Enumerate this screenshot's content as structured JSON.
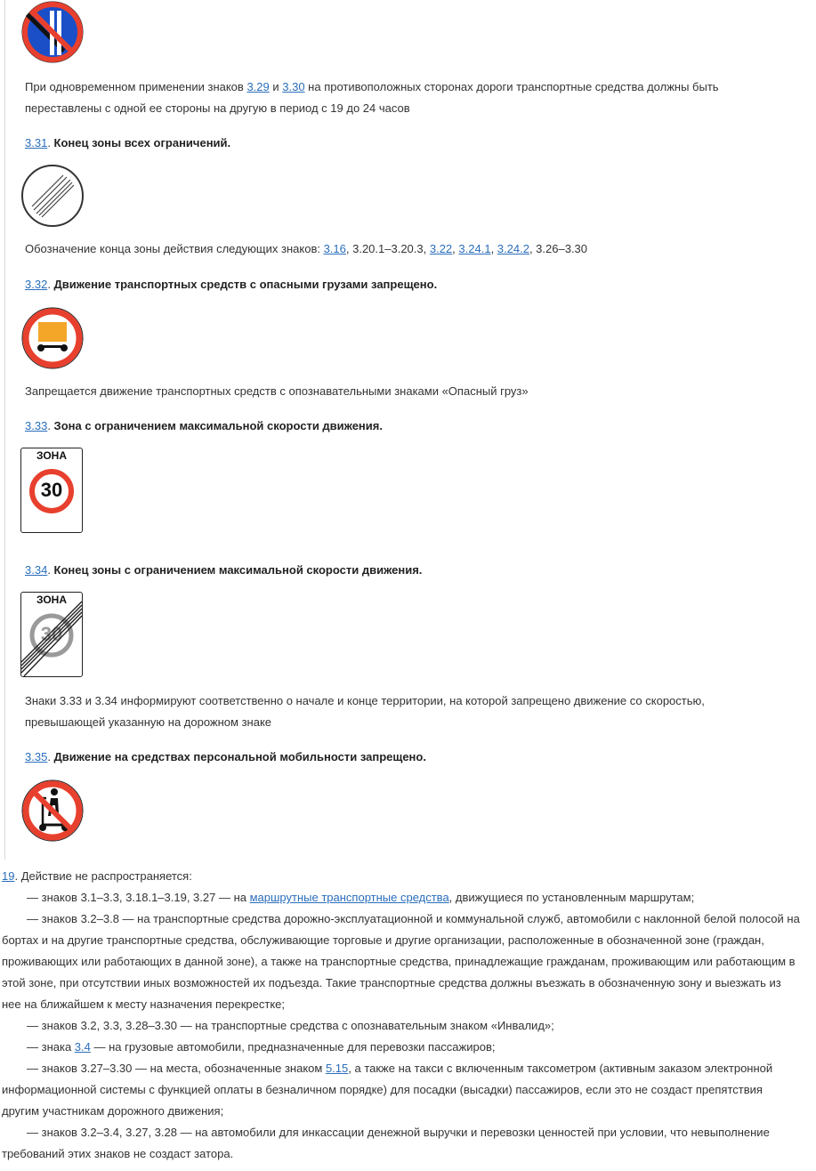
{
  "block": {
    "p329_330": {
      "t1": "При одновременном применении знаков ",
      "link1": "3.29",
      "t2": " и ",
      "link2": "3.30",
      "t3": " на противоположных сторонах дороги транспортные средства должны быть",
      "line2": "переставлены с одной ее стороны на другую в период с 19 до 24 часов"
    },
    "s331": {
      "num": "3.31",
      "title": "Конец зоны всех ограничений.",
      "desc_t1": "Обозначение конца зоны действия следующих знаков: ",
      "desc_l1": "3.16",
      "desc_t2": ", 3.20.1–3.20.3, ",
      "desc_l2": "3.22",
      "desc_t3": ", ",
      "desc_l3": "3.24.1",
      "desc_t4": ", ",
      "desc_l4": "3.24.2",
      "desc_t5": ", 3.26–3.30"
    },
    "s332": {
      "num": "3.32",
      "title": "Движение транспортных средств с опасными грузами запрещено.",
      "desc": "Запрещается движение транспортных средств с опознавательными знаками «Опасный груз»"
    },
    "s333": {
      "num": "3.33",
      "title": "Зона с ограничением максимальной скорости движения.",
      "zone": "ЗОНА",
      "speed": "30"
    },
    "s334": {
      "num": "3.34",
      "title": "Конец зоны с ограничением максимальной скорости движения.",
      "zone": "ЗОНА",
      "speed": "30",
      "desc1": "Знаки 3.33 и 3.34 информируют соответственно о начале и конце территории, на которой запрещено движение со скоростью,",
      "desc2": "превышающей указанную на дорожном знаке"
    },
    "s335": {
      "num": "3.35",
      "title": "Движение на средствах персональной мобильности запрещено."
    }
  },
  "footnote": {
    "num": "19",
    "intro": ". Действие не распространяется:",
    "i1_t1": "— знаков 3.1–3.3, 3.18.1–3.19, 3.27 — на ",
    "i1_link": "маршрутные транспортные средства",
    "i1_t2": ", движущиеся по установленным маршрутам;",
    "i2": "— знаков 3.2–3.8 — на транспортные средства дорожно-эксплуатационной и коммунальной служб, автомобили с наклонной белой полосой на бортах и на другие транспортные средства, обслуживающие торговые и другие организации, расположенные в обозначенной зоне (граждан, проживающих или работающих в данной зоне), а также на транспортные средства, принадлежащие гражданам, проживающим или работающим в этой зоне, при отсутствии иных возможностей их подъезда. Такие транспортные средства должны въезжать в обозначенную зону и выезжать из нее на ближайшем к месту назначения перекрестке;",
    "i3": "— знаков 3.2, 3.3, 3.28–3.30 — на транспортные средства с опознавательным знаком «Инвалид»;",
    "i4_t1": "— знака ",
    "i4_link": "3.4",
    "i4_t2": " — на грузовые автомобили, предназначенные для перевозки пассажиров;",
    "i5_t1": "— знаков 3.27–3.30 — на места, обозначенные знаком ",
    "i5_link": "5.15",
    "i5_t2": ", а также на такси с включенным таксометром (активным заказом электронной информационной системы с функцией оплаты в безналичном порядке) для посадки (высадки) пассажиров, если это не создаст препятствия другим участникам дорожного движения;",
    "i6": "— знаков 3.2–3.4, 3.27, 3.28 — на автомобили для инкассации денежной выручки и перевозки ценностей при условии, что невыполнение требований этих знаков не создаст затора."
  },
  "colors": {
    "link": "#2a6ebb",
    "sign_red": "#e8402e",
    "sign_blue": "#1a4fc8",
    "cargo_orange": "#f4a629"
  },
  "icons": [
    "no-parking-even-days-sign-icon",
    "end-of-all-restrictions-sign-icon",
    "no-dangerous-goods-sign-icon",
    "speed-zone-sign-icon",
    "end-speed-zone-sign-icon",
    "no-scooter-sign-icon"
  ]
}
